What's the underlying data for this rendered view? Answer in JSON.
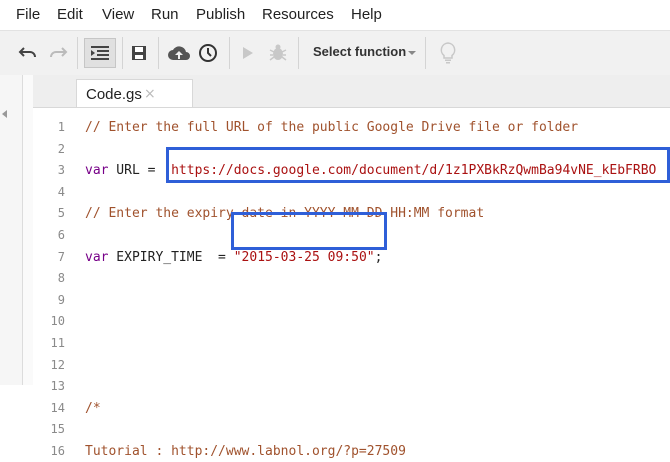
{
  "menu": [
    "File",
    "Edit",
    "View",
    "Run",
    "Publish",
    "Resources",
    "Help"
  ],
  "toolbar": {
    "undo_icon": "undo-icon",
    "redo_icon": "redo-icon",
    "indent_icon": "indent-icon",
    "save_icon": "save-icon",
    "deploy_icon": "cloud-upload-icon",
    "triggers_icon": "clock-icon",
    "run_icon": "play-icon",
    "debug_icon": "bug-icon",
    "select_function_label": "Select function",
    "hint_icon": "lightbulb-icon"
  },
  "tab": {
    "label": "Code.gs",
    "close": "×"
  },
  "code": {
    "lines": [
      {
        "n": "1",
        "parts": [
          {
            "t": "// Enter the full URL of the public Google Drive file or folder",
            "c": "cm"
          }
        ]
      },
      {
        "n": "2",
        "parts": []
      },
      {
        "n": "3",
        "parts": [
          {
            "t": "var",
            "c": "kw"
          },
          {
            "t": " URL = ",
            "c": "tx"
          },
          {
            "t": "'https://docs.google.com/document/d/1z1PXBkRzQwmBa94vNE_kEbFRBO",
            "c": "st"
          }
        ]
      },
      {
        "n": "4",
        "parts": []
      },
      {
        "n": "5",
        "parts": [
          {
            "t": "// Enter the expiry date in YYYY-MM-DD HH:MM format",
            "c": "cm"
          }
        ]
      },
      {
        "n": "6",
        "parts": []
      },
      {
        "n": "7",
        "parts": [
          {
            "t": "var",
            "c": "kw"
          },
          {
            "t": " EXPIRY_TIME  = ",
            "c": "tx"
          },
          {
            "t": "\"2015-03-25 09:50\"",
            "c": "st"
          },
          {
            "t": ";",
            "c": "tx"
          }
        ]
      },
      {
        "n": "8",
        "parts": []
      },
      {
        "n": "9",
        "parts": []
      },
      {
        "n": "10",
        "parts": []
      },
      {
        "n": "11",
        "parts": []
      },
      {
        "n": "12",
        "parts": []
      },
      {
        "n": "13",
        "parts": []
      },
      {
        "n": "14",
        "parts": [
          {
            "t": "/*",
            "c": "cm"
          }
        ]
      },
      {
        "n": "15",
        "parts": []
      },
      {
        "n": "16",
        "parts": [
          {
            "t": "Tutorial : http://www.labnol.org/?p=27509",
            "c": "cm"
          }
        ]
      }
    ]
  },
  "colors": {
    "comment": "#a0522d",
    "keyword": "#770088",
    "string": "#aa1111",
    "highlight": "#2f5fd8"
  }
}
